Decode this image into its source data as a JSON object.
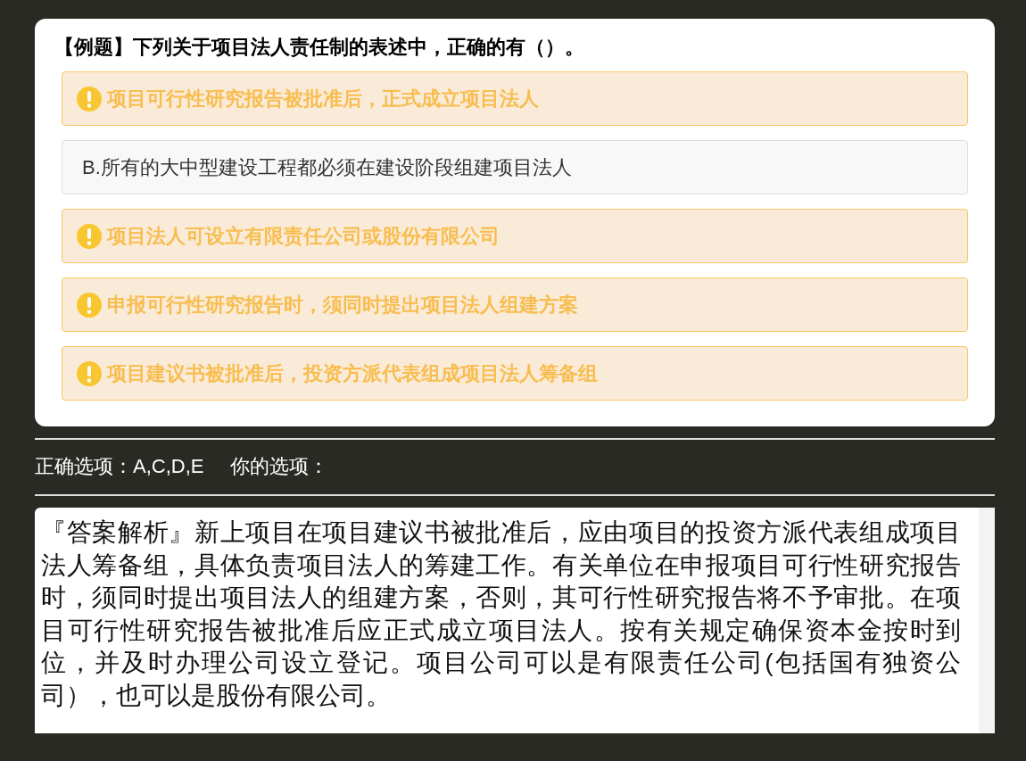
{
  "question": {
    "title": "【例题】下列关于项目法人责任制的表述中，正确的有（）。",
    "options": [
      {
        "kind": "correct",
        "text": "项目可行性研究报告被批准后，正式成立项目法人"
      },
      {
        "kind": "plain",
        "letter": "B.",
        "text": "所有的大中型建设工程都必须在建设阶段组建项目法人"
      },
      {
        "kind": "correct",
        "text": "项目法人可设立有限责任公司或股份有限公司"
      },
      {
        "kind": "correct",
        "text": "申报可行性研究报告时，须同时提出项目法人组建方案"
      },
      {
        "kind": "correct",
        "text": "项目建议书被批准后，投资方派代表组成项目法人筹备组"
      }
    ]
  },
  "answer": {
    "correct": "正确选项：A,C,D,E",
    "yours": "你的选项："
  },
  "explanation": "『答案解析』新上项目在项目建议书被批准后，应由项目的投资方派代表组成项目法人筹备组，具体负责项目法人的筹建工作。有关单位在申报项目可行性研究报告时，须同时提出项目法人的组建方案，否则，其可行性研究报告将不予审批。在项目可行性研究报告被批准后应正式成立项目法人。按有关规定确保资本金按时到位，并及时办理公司设立登记。项目公司可以是有限责任公司(包括国有独资公司），也可以是股份有限公司。"
}
